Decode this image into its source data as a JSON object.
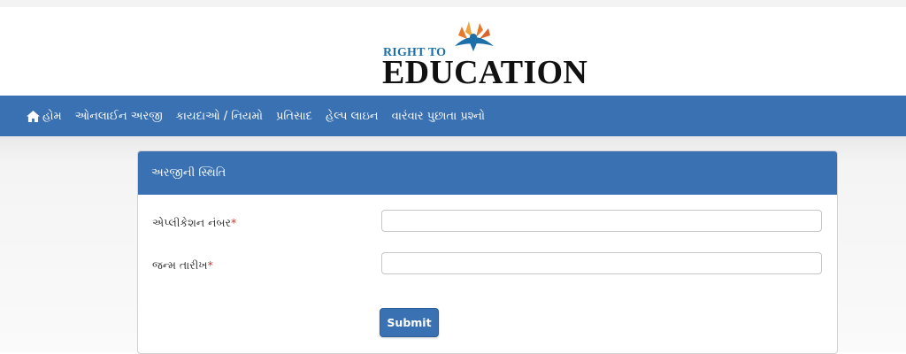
{
  "logo": {
    "line1": "RIGHT TO",
    "line2": "EDUCATION",
    "icon": "person-with-book-emblem"
  },
  "nav": {
    "items": [
      {
        "label": "હોમ",
        "icon": "home-icon"
      },
      {
        "label": "ઓનલાઈન અરજી"
      },
      {
        "label": "કાયદાઓ / નિયમો"
      },
      {
        "label": "પ્રતિસાદ"
      },
      {
        "label": "હેલ્પ લાઇન"
      },
      {
        "label": "વારંવાર પુછાતા પ્રશ્નો"
      }
    ]
  },
  "panel": {
    "title": "અરજીની સ્થિતિ",
    "fields": [
      {
        "label": "એપ્લીકેશન નંબર",
        "required_mark": "*",
        "value": ""
      },
      {
        "label": "જન્મ તારીખ",
        "required_mark": "*",
        "value": ""
      }
    ],
    "submit_label": "Submit"
  },
  "colors": {
    "primary": "#3a71b3",
    "logo_accent": "#1d6fa8",
    "emblem_orange": "#e8792b",
    "required": "#c0392b"
  }
}
